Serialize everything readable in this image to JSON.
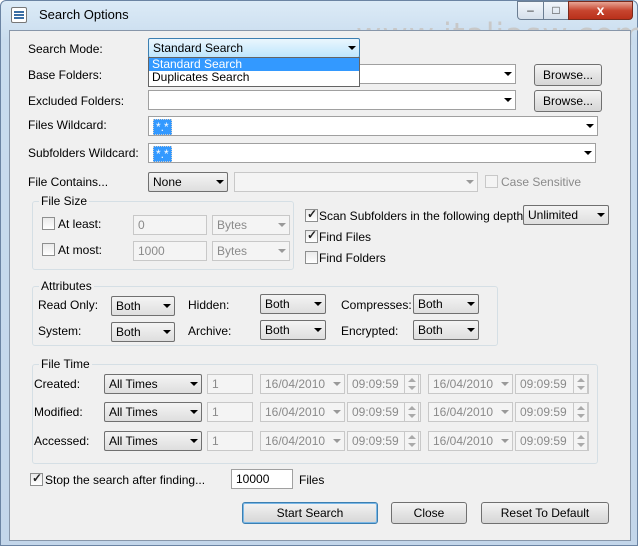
{
  "window": {
    "title": "Search Options",
    "minimize": "–",
    "maximize": "□",
    "close": "x"
  },
  "watermark": "www.italiasw.com",
  "search_mode": {
    "label": "Search Mode:",
    "value": "Standard Search",
    "options": [
      "Standard Search",
      "Duplicates Search"
    ]
  },
  "base_folders": {
    "label": "Base Folders:",
    "browse": "Browse..."
  },
  "excluded_folders": {
    "label": "Excluded Folders:",
    "browse": "Browse..."
  },
  "files_wildcard": {
    "label": "Files Wildcard:",
    "value": "*.*"
  },
  "subfolders_wildcard": {
    "label": "Subfolders Wildcard:",
    "value": "*.*"
  },
  "file_contains": {
    "label": "File Contains...",
    "mode": "None",
    "value": "",
    "case_sensitive": "Case Sensitive"
  },
  "file_size": {
    "caption": "File Size",
    "at_least": {
      "label": "At least:",
      "value": "0",
      "unit": "Bytes"
    },
    "at_most": {
      "label": "At most:",
      "value": "1000",
      "unit": "Bytes"
    }
  },
  "scan": {
    "label": "Scan Subfolders in the following depth:",
    "depth": "Unlimited"
  },
  "find_files": "Find Files",
  "find_folders": "Find Folders",
  "attributes": {
    "caption": "Attributes",
    "read_only": {
      "label": "Read Only:",
      "value": "Both"
    },
    "hidden": {
      "label": "Hidden:",
      "value": "Both"
    },
    "compresses": {
      "label": "Compresses:",
      "value": "Both"
    },
    "system": {
      "label": "System:",
      "value": "Both"
    },
    "archive": {
      "label": "Archive:",
      "value": "Both"
    },
    "encrypted": {
      "label": "Encrypted:",
      "value": "Both"
    }
  },
  "file_time": {
    "caption": "File Time",
    "rows": [
      {
        "label": "Created:",
        "mode": "All Times",
        "num": "1",
        "d1": "16/04/2010",
        "t1": "09:09:59",
        "d2": "16/04/2010",
        "t2": "09:09:59"
      },
      {
        "label": "Modified:",
        "mode": "All Times",
        "num": "1",
        "d1": "16/04/2010",
        "t1": "09:09:59",
        "d2": "16/04/2010",
        "t2": "09:09:59"
      },
      {
        "label": "Accessed:",
        "mode": "All Times",
        "num": "1",
        "d1": "16/04/2010",
        "t1": "09:09:59",
        "d2": "16/04/2010",
        "t2": "09:09:59"
      }
    ]
  },
  "stop": {
    "label": "Stop the search after finding...",
    "value": "10000",
    "unit": "Files"
  },
  "buttons": {
    "start": "Start Search",
    "close": "Close",
    "reset": "Reset To Default"
  }
}
